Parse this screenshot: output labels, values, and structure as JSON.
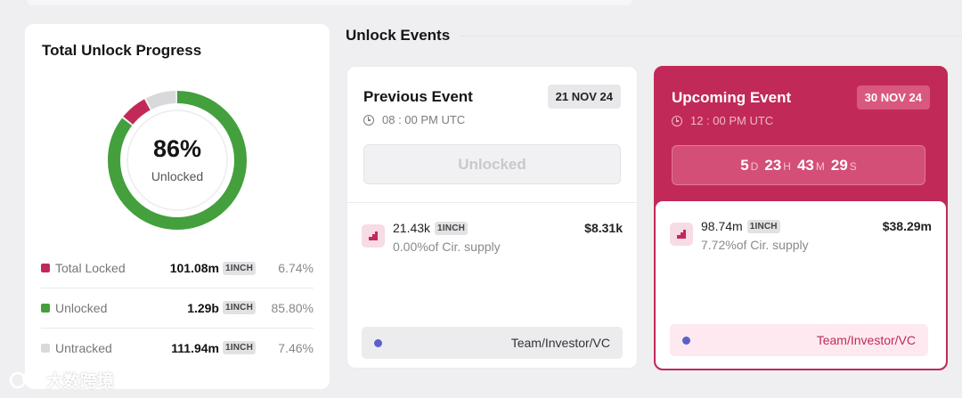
{
  "progress": {
    "title": "Total Unlock Progress",
    "percent": "86%",
    "percent_label": "Unlocked",
    "token": "1INCH",
    "legend": [
      {
        "name": "Total Locked",
        "amount": "101.08m",
        "percent": "6.74%",
        "color": "#c12a58",
        "share": 6.74
      },
      {
        "name": "Unlocked",
        "amount": "1.29b",
        "percent": "85.80%",
        "color": "#43a03d",
        "share": 85.8
      },
      {
        "name": "Untracked",
        "amount": "111.94m",
        "percent": "7.46%",
        "color": "#d9d9dc",
        "share": 7.46
      }
    ]
  },
  "unlock_events": {
    "title": "Unlock Events",
    "previous": {
      "title": "Previous Event",
      "date": "21 NOV 24",
      "time": "08 : 00 PM UTC",
      "status": "Unlocked",
      "amount": "21.43k",
      "token": "1INCH",
      "usd": "$8.31k",
      "supply": "0.00%of Cir. supply",
      "category": "Team/Investor/VC"
    },
    "upcoming": {
      "title": "Upcoming Event",
      "date": "30 NOV 24",
      "time": "12 : 00 PM UTC",
      "countdown": {
        "days": "5",
        "d": "D",
        "hours": "23",
        "h": "H",
        "minutes": "43",
        "m": "M",
        "seconds": "29",
        "s": "S"
      },
      "amount": "98.74m",
      "token": "1INCH",
      "usd": "$38.29m",
      "supply": "7.72%of Cir. supply",
      "category": "Team/Investor/VC"
    }
  },
  "watermark": "大数跨境",
  "icons": {
    "clock": "clock-icon",
    "unlock": "unlock-step-icon",
    "dot": "category-dot-icon"
  },
  "colors": {
    "accent": "#c12a58",
    "unlocked": "#43a03d",
    "untracked": "#d9d9dc",
    "category_dot": "#5b60c8"
  }
}
